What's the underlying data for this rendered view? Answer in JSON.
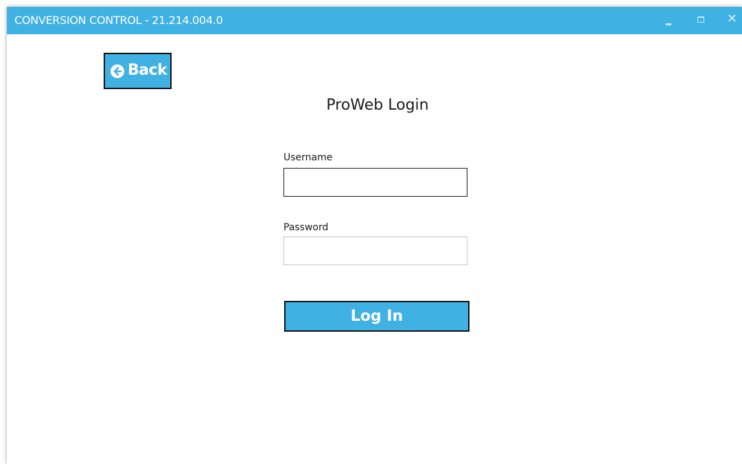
{
  "window": {
    "title": "CONVERSION CONTROL - 21.214.004.0",
    "controls": {
      "minimize": "minimize-icon",
      "maximize": "maximize-icon",
      "close": "close-icon"
    }
  },
  "toolbar": {
    "back_label": "Back",
    "back_icon": "arrow-left-circle-icon"
  },
  "login": {
    "title": "ProWeb Login",
    "username_label": "Username",
    "username_value": "",
    "password_label": "Password",
    "password_value": "",
    "submit_label": "Log In"
  },
  "colors": {
    "accent": "#3fb1e3",
    "border_dark": "#111111",
    "border_light": "#c4c4c4",
    "background": "#ffffff"
  }
}
